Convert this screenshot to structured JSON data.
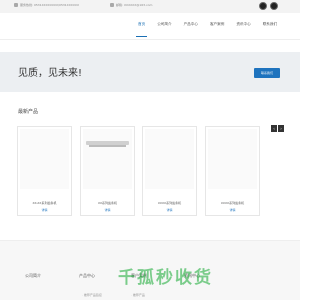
{
  "topbar": {
    "phone": "服务热线: 0531XXXXXXXX/0531XXXXXX",
    "email": "邮箱: XXXXXX@163.com",
    "social": [
      {
        "icon": "wechat-icon"
      },
      {
        "icon": "weibo-icon"
      }
    ]
  },
  "nav": {
    "items": [
      {
        "label": "首页",
        "active": true
      },
      {
        "label": "公司简介"
      },
      {
        "label": "产品中心"
      },
      {
        "label": "客户案例"
      },
      {
        "label": "资讯中心"
      },
      {
        "label": "联系我们"
      }
    ]
  },
  "hero": {
    "welcome": "见质，见未来!",
    "button": "联系我们"
  },
  "products": {
    "title": "最新产品",
    "prev": "‹",
    "next": "›",
    "items": [
      {
        "name": "XX-XX系列齿条机",
        "more": "详情"
      },
      {
        "name": "XX系列齿条机",
        "more": "详情"
      },
      {
        "name": "XXXX系列齿条机",
        "more": "详情"
      },
      {
        "name": "XXXX系列齿条机",
        "more": "详情"
      }
    ]
  },
  "footer": {
    "cols": [
      "公司简介",
      "产品中心",
      "客户案例",
      "资讯中心"
    ],
    "sub": [
      "· 推荐产品链接",
      "· 推荐产品"
    ]
  },
  "watermark": "千孤秒收货",
  "colors": {
    "accent": "#1e73be",
    "watermark": "#14aa32"
  }
}
